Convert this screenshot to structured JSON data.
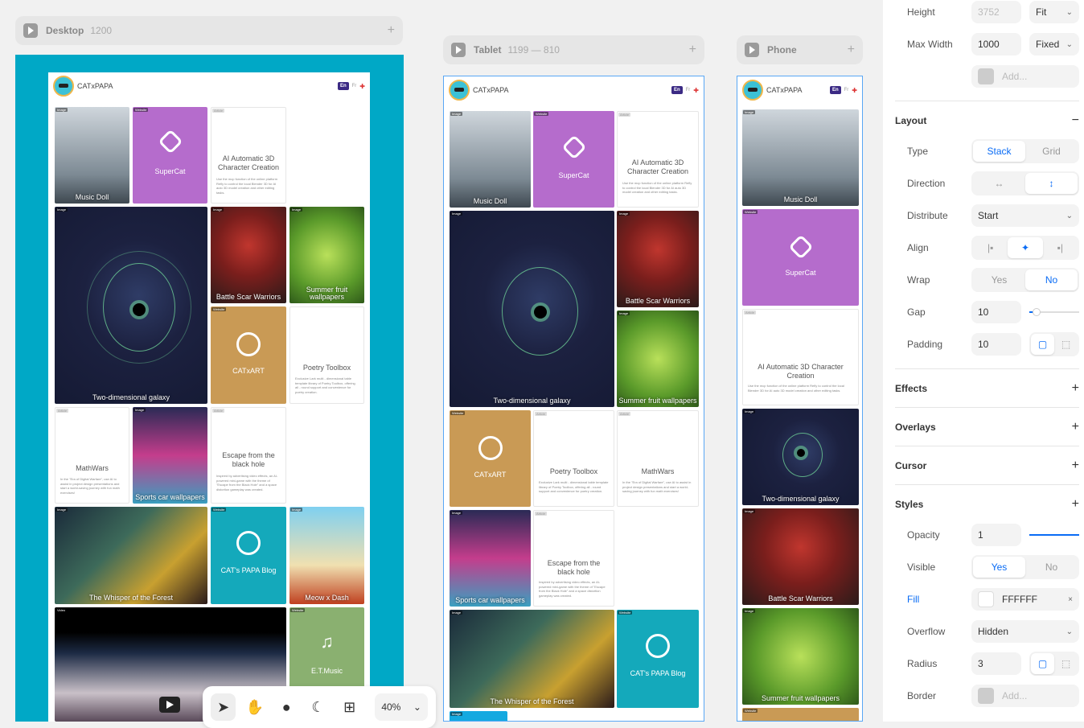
{
  "breakpoints": {
    "desktop": {
      "title": "Desktop",
      "size": "1200",
      "add": "+"
    },
    "tablet": {
      "title": "Tablet",
      "size": "1199 — 810",
      "add": "+"
    },
    "phone": {
      "title": "Phone",
      "size": "",
      "add": "+"
    }
  },
  "site": {
    "brand": "CATxPAPA",
    "lang_en": "En",
    "lang_fr": "Fr",
    "labels": {
      "image": "Image",
      "website": "Website",
      "article": "Article",
      "video": "Video"
    }
  },
  "cards": {
    "music_doll": "Music Doll",
    "supercat": "SuperCat",
    "ai3d_title": "AI Automatic 3D Character Creation",
    "ai3d_desc": "Use the mcp function of the online platform Refly to control the local Blender 3D for AI auto 3D model creation and other editing tasks.",
    "galaxy": "Two-dimensional galaxy",
    "battle": "Battle Scar Warriors",
    "summer": "Summer fruit wallpapers",
    "catxart": "CATxART",
    "poetry_title": "Poetry Toolbox",
    "poetry_desc": "Exclusive Lark multi - dimensional table template library of Poetry Toolbox, offering all - round support and convenience for poetry creation.",
    "mathwars_title": "MathWars",
    "mathwars_desc": "In the \"Era of Digital Warfare\", use AI to assist in project design presentations and start a world-saving journey with fun math exercises!",
    "sports": "Sports car wallpapers",
    "escape_title": "Escape from the black hole",
    "escape_desc": "Inspired by advertising video effects, an AI-powered mini-game with the theme of \"Escape from the Black Hole\" and a space distortion gameplay was created.",
    "whisper": "The Whisper of the Forest",
    "blog": "CAT's PAPA Blog",
    "meow": "Meow x Dash",
    "music": "E.T.Music"
  },
  "toolbar": {
    "zoom": "40%",
    "chevron": "⌄"
  },
  "panel": {
    "height_label": "Height",
    "height_value": "3752",
    "height_mode": "Fit",
    "maxwidth_label": "Max Width",
    "maxwidth_value": "1000",
    "maxwidth_mode": "Fixed",
    "add_placeholder": "Add...",
    "layout_title": "Layout",
    "type_label": "Type",
    "type_stack": "Stack",
    "type_grid": "Grid",
    "direction_label": "Direction",
    "distribute_label": "Distribute",
    "distribute_value": "Start",
    "align_label": "Align",
    "wrap_label": "Wrap",
    "wrap_yes": "Yes",
    "wrap_no": "No",
    "gap_label": "Gap",
    "gap_value": "10",
    "padding_label": "Padding",
    "padding_value": "10",
    "effects_title": "Effects",
    "overlays_title": "Overlays",
    "cursor_title": "Cursor",
    "styles_title": "Styles",
    "opacity_label": "Opacity",
    "opacity_value": "1",
    "opacity_fraction": 1,
    "visible_label": "Visible",
    "visible_yes": "Yes",
    "visible_no": "No",
    "fill_label": "Fill",
    "fill_value": "FFFFFF",
    "overflow_label": "Overflow",
    "overflow_value": "Hidden",
    "radius_label": "Radius",
    "radius_value": "3",
    "border_label": "Border",
    "border_placeholder": "Add..."
  },
  "colors": {
    "accent": "#0a6cf5",
    "desktop_bg": "#00a8c6",
    "purple": "#b56ccc",
    "tan": "#c99a55",
    "teal": "#14a9bb"
  }
}
